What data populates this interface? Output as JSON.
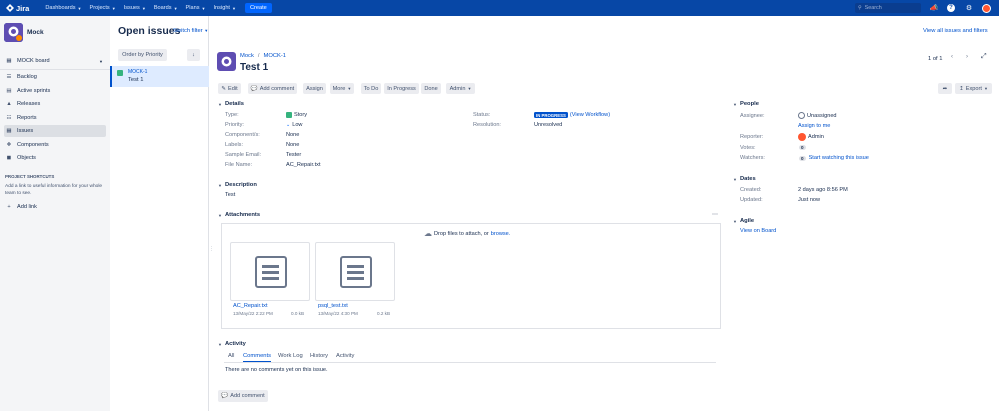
{
  "topbar": {
    "logo": "Jira",
    "nav": [
      "Dashboards",
      "Projects",
      "Issues",
      "Boards",
      "Plans",
      "Insight"
    ],
    "create": "Create",
    "search_placeholder": "Search"
  },
  "sidebar": {
    "project_name": "Mock",
    "board": "MOCK board",
    "items": [
      {
        "label": "Backlog",
        "icon": "backlog-icon"
      },
      {
        "label": "Active sprints",
        "icon": "sprint-icon"
      },
      {
        "label": "Releases",
        "icon": "ship-icon"
      },
      {
        "label": "Reports",
        "icon": "chart-icon"
      },
      {
        "label": "Issues",
        "icon": "issues-icon"
      },
      {
        "label": "Components",
        "icon": "puzzle-icon"
      },
      {
        "label": "Objects",
        "icon": "objects-icon"
      }
    ],
    "shortcuts_title": "PROJECT SHORTCUTS",
    "shortcuts_text": "Add a link to useful information for your whole team to see.",
    "add_link": "Add link"
  },
  "header": {
    "title": "Open issues",
    "switch_filter": "Switch filter",
    "view_all": "View all issues and filters"
  },
  "list": {
    "order_by": "Order by Priority",
    "issues": [
      {
        "key": "MOCK-1",
        "summary": "Test 1"
      }
    ]
  },
  "issue": {
    "project": "Mock",
    "key": "MOCK-1",
    "title": "Test 1",
    "pager": "1 of 1",
    "toolbar": {
      "edit": "Edit",
      "add_comment": "Add comment",
      "assign": "Assign",
      "more": "More",
      "todo": "To Do",
      "in_progress": "In Progress",
      "done": "Done",
      "admin": "Admin",
      "export": "Export"
    },
    "details_heading": "Details",
    "details": [
      {
        "label": "Type:",
        "value": "Story"
      },
      {
        "label": "Priority:",
        "value": "Low"
      },
      {
        "label": "Component/s:",
        "value": "None"
      },
      {
        "label": "Labels:",
        "value": "None"
      },
      {
        "label": "Sample Email:",
        "value": "Tester"
      },
      {
        "label": "File Name:",
        "value": "AC_Repair.txt"
      }
    ],
    "status_label": "Status:",
    "status_badge": "IN PROGRESS",
    "view_workflow": "(View Workflow)",
    "resolution_label": "Resolution:",
    "resolution": "Unresolved",
    "description_heading": "Description",
    "description": "Test",
    "attachments_heading": "Attachments",
    "drop_text": "Drop files to attach, or",
    "browse": "browse.",
    "attachments": [
      {
        "name": "AC_Repair.txt",
        "date": "13/May/22 2:22 PM",
        "size": "0.0 kB"
      },
      {
        "name": "psql_test.txt",
        "date": "13/May/22 4:30 PM",
        "size": "0.2 kB"
      }
    ],
    "activity_heading": "Activity",
    "activity_tabs": [
      "All",
      "Comments",
      "Work Log",
      "History",
      "Activity"
    ],
    "no_comments": "There are no comments yet on this issue.",
    "add_comment_bottom": "Add comment"
  },
  "people": {
    "heading": "People",
    "assignee_label": "Assignee:",
    "assignee": "Unassigned",
    "assign_to_me": "Assign to me",
    "reporter_label": "Reporter:",
    "reporter": "Admin",
    "votes_label": "Votes:",
    "votes": "0",
    "watchers_label": "Watchers:",
    "watchers": "0",
    "start_watching": "Start watching this issue"
  },
  "dates": {
    "heading": "Dates",
    "created_label": "Created:",
    "created": "2 days ago 8:56 PM",
    "updated_label": "Updated:",
    "updated": "Just now"
  },
  "agile": {
    "heading": "Agile",
    "view_on_board": "View on Board"
  }
}
